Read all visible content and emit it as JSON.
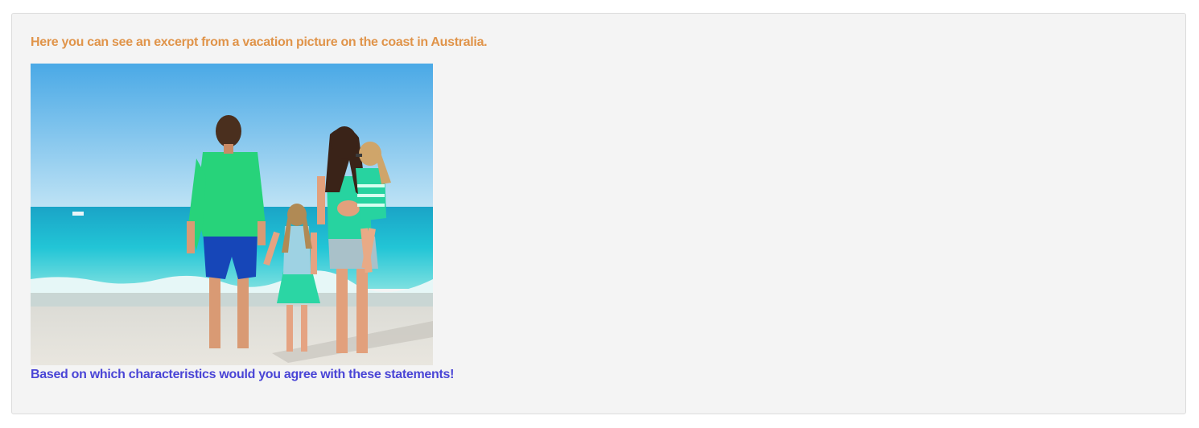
{
  "intro_text": "Here you can see an excerpt from a vacation picture on the coast in Australia.",
  "question_text": "Based on which characteristics would you agree with these statements!",
  "colors": {
    "intro": "#e0944a",
    "question": "#4a45d6",
    "panel_background": "#f4f4f4",
    "panel_border": "#dcdcdc"
  }
}
